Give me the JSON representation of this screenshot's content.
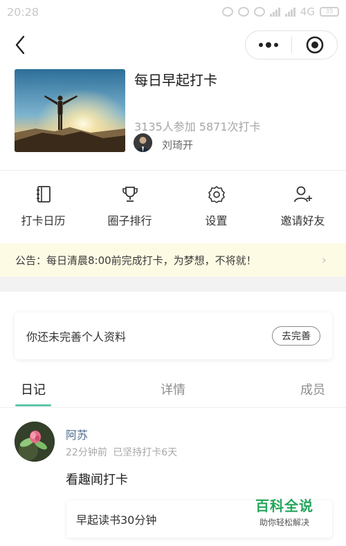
{
  "status_bar": {
    "time": "20:28",
    "network": "4G",
    "battery": "35"
  },
  "nav": {
    "back_icon": "chevron-left-icon",
    "more_icon": "more-dots-icon",
    "close_icon": "record-circle-icon"
  },
  "circle": {
    "title": "每日早起打卡",
    "stats": "3135人参加 5871次打卡",
    "owner_name": "刘琦开"
  },
  "actions": [
    {
      "label": "打卡日历",
      "icon": "calendar-notebook-icon"
    },
    {
      "label": "圈子排行",
      "icon": "trophy-icon"
    },
    {
      "label": "设置",
      "icon": "gear-icon"
    },
    {
      "label": "邀请好友",
      "icon": "add-user-icon"
    }
  ],
  "notice": {
    "text": "公告：每日清晨8:00前完成打卡，为梦想，不将就！"
  },
  "profile_prompt": {
    "text": "你还未完善个人资料",
    "button": "去完善"
  },
  "tabs": [
    {
      "label": "日记",
      "active": true
    },
    {
      "label": "详情",
      "active": false
    },
    {
      "label": "成员",
      "active": false
    }
  ],
  "post": {
    "author": "阿苏",
    "time": "22分钟前",
    "streak": "已坚持打卡6天",
    "body": "看趣闻打卡",
    "task": "早起读书30分钟"
  },
  "watermark": {
    "title": "百科全说",
    "subtitle": "助你轻松解决"
  },
  "colors": {
    "accent": "#5bc6a8",
    "notice_bg": "#fdfbe4",
    "author_link": "#4e6a8d",
    "watermark": "#25a65c"
  }
}
